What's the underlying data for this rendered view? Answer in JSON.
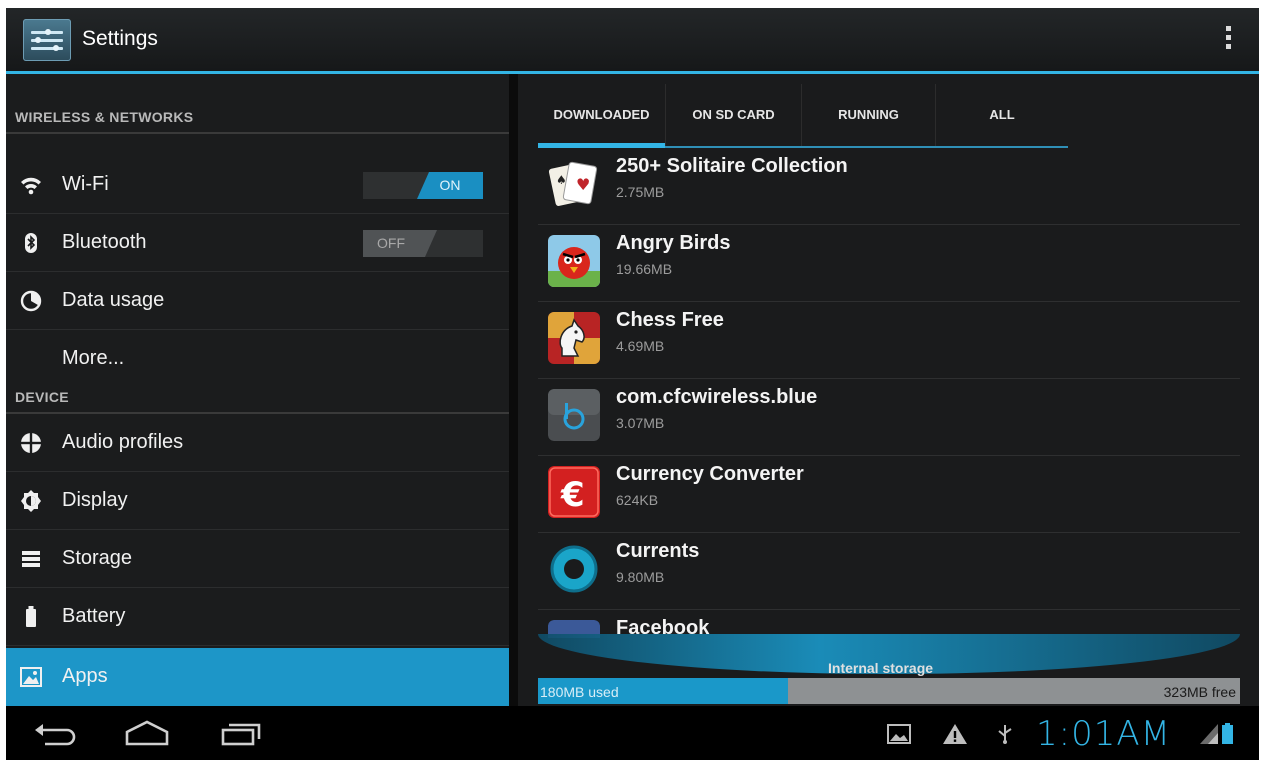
{
  "action_bar": {
    "title": "Settings",
    "app_icon": "settings-sliders-icon",
    "overflow_icon": "overflow-menu-icon"
  },
  "settings": {
    "sections": [
      {
        "header": "WIRELESS & NETWORKS",
        "items": [
          {
            "label": "Wi-Fi",
            "icon": "wifi-icon",
            "toggle": "ON"
          },
          {
            "label": "Bluetooth",
            "icon": "bluetooth-icon",
            "toggle": "OFF"
          },
          {
            "label": "Data usage",
            "icon": "data-usage-icon"
          },
          {
            "label": "More...",
            "icon": ""
          }
        ]
      },
      {
        "header": "DEVICE",
        "items": [
          {
            "label": "Audio profiles",
            "icon": "audio-profiles-icon"
          },
          {
            "label": "Display",
            "icon": "display-icon"
          },
          {
            "label": "Storage",
            "icon": "storage-icon"
          },
          {
            "label": "Battery",
            "icon": "battery-icon"
          },
          {
            "label": "Apps",
            "icon": "apps-icon",
            "selected": true
          }
        ]
      }
    ]
  },
  "apps": {
    "tabs": [
      "DOWNLOADED",
      "ON SD CARD",
      "RUNNING",
      "ALL"
    ],
    "active_tab": "DOWNLOADED",
    "list": [
      {
        "name": "250+ Solitaire Collection",
        "size": "2.75MB",
        "icon": "solitaire-icon"
      },
      {
        "name": "Angry Birds",
        "size": "19.66MB",
        "icon": "angry-birds-icon"
      },
      {
        "name": "Chess Free",
        "size": "4.69MB",
        "icon": "chess-icon"
      },
      {
        "name": "com.cfcwireless.blue",
        "size": "3.07MB",
        "icon": "cfcwireless-icon"
      },
      {
        "name": "Currency Converter",
        "size": "624KB",
        "icon": "currency-converter-icon"
      },
      {
        "name": "Currents",
        "size": "9.80MB",
        "icon": "currents-icon"
      },
      {
        "name": "Facebook",
        "size": "",
        "icon": "facebook-icon"
      }
    ],
    "storage": {
      "title": "Internal storage",
      "used": "180MB used",
      "free": "323MB free"
    }
  },
  "system_bar": {
    "clock": "1:01AM",
    "nav": [
      "back-icon",
      "home-icon",
      "recent-apps-icon"
    ],
    "status_icons": [
      "gallery-notification-icon",
      "warning-icon",
      "usb-icon",
      "signal-battery-icon"
    ]
  },
  "colors": {
    "accent": "#33b5e5",
    "selected": "#1d96c8",
    "background": "#1b1c1d"
  }
}
